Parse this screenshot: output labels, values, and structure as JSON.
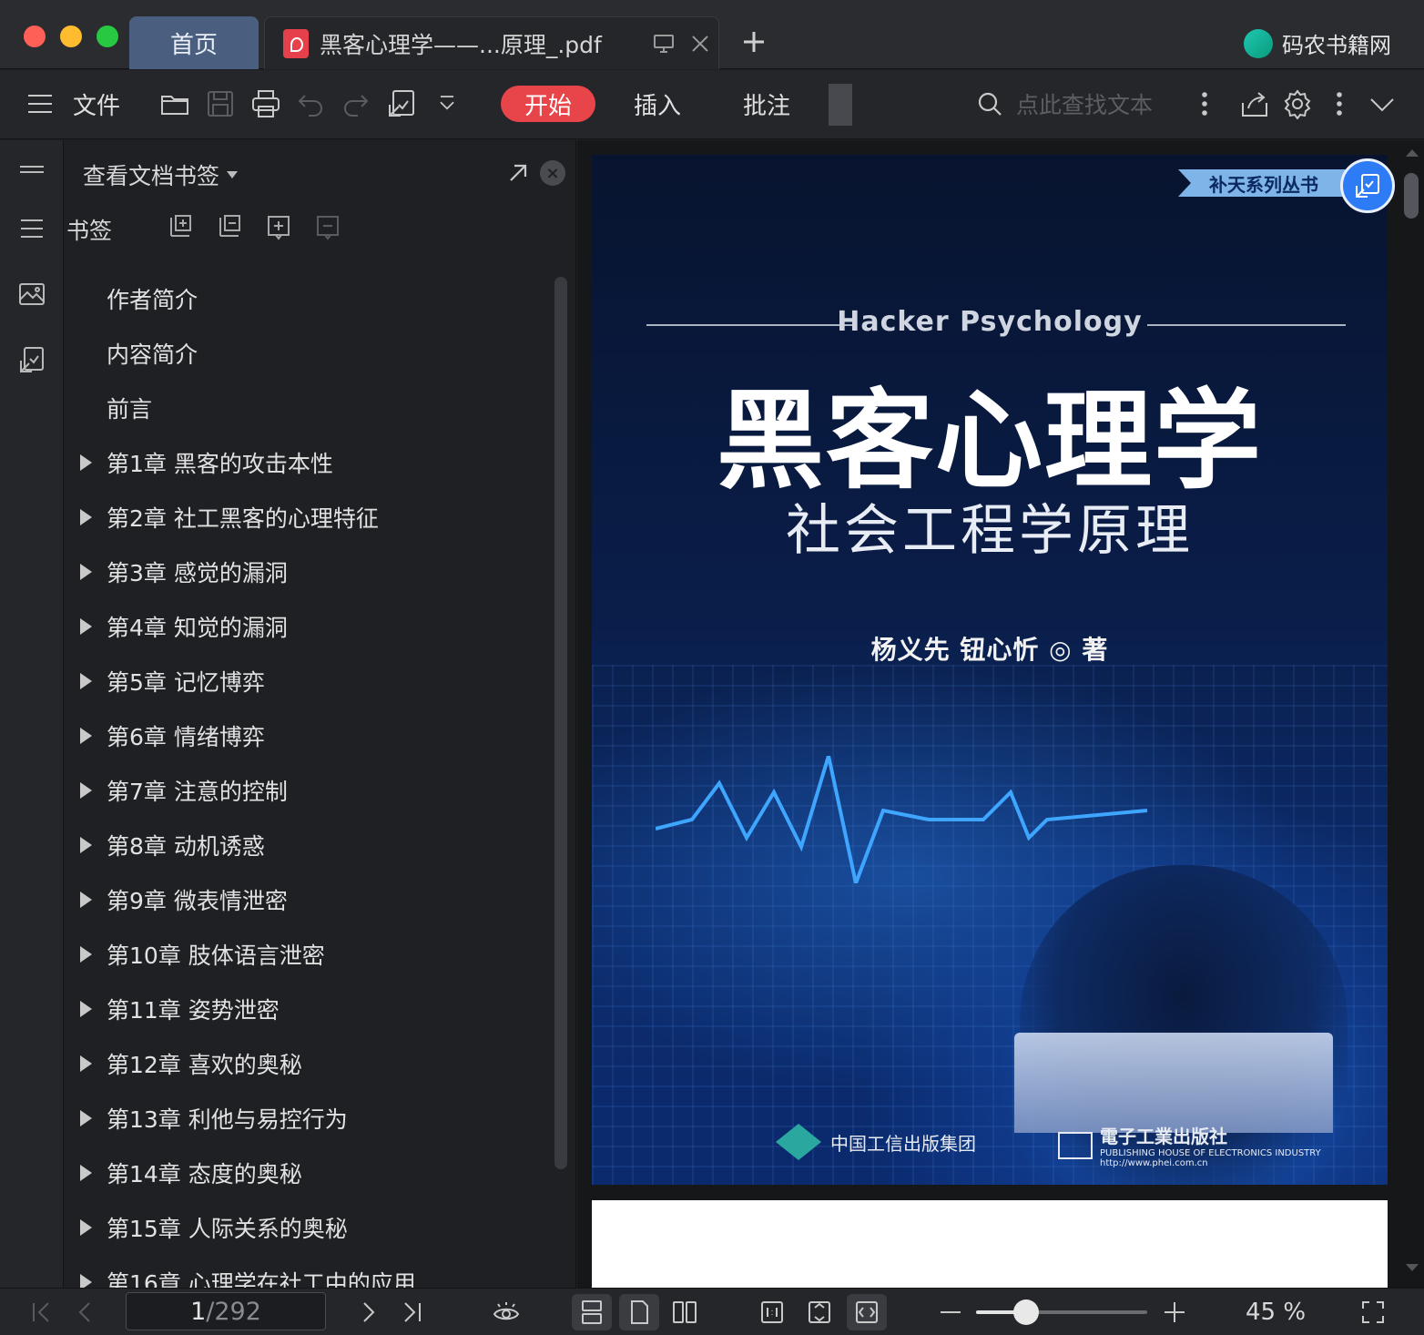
{
  "window": {
    "home_tab": "首页",
    "doc_tab": "黑客心理学——...原理_.pdf",
    "brand": "码农书籍网"
  },
  "toolbar": {
    "file_label": "文件",
    "tabs": [
      "开始",
      "插入",
      "批注"
    ],
    "active_tab": "开始",
    "search_placeholder": "点此查找文本"
  },
  "bookmark_panel": {
    "header": "查看文档书签",
    "section_label": "书签",
    "items": [
      {
        "label": "作者简介",
        "expandable": false
      },
      {
        "label": "内容简介",
        "expandable": false
      },
      {
        "label": "前言",
        "expandable": false
      },
      {
        "label": "第1章 黑客的攻击本性",
        "expandable": true
      },
      {
        "label": "第2章 社工黑客的心理特征",
        "expandable": true
      },
      {
        "label": "第3章 感觉的漏洞",
        "expandable": true
      },
      {
        "label": "第4章 知觉的漏洞",
        "expandable": true
      },
      {
        "label": "第5章 记忆博弈",
        "expandable": true
      },
      {
        "label": "第6章 情绪博弈",
        "expandable": true
      },
      {
        "label": "第7章 注意的控制",
        "expandable": true
      },
      {
        "label": "第8章 动机诱惑",
        "expandable": true
      },
      {
        "label": "第9章 微表情泄密",
        "expandable": true
      },
      {
        "label": "第10章 肢体语言泄密",
        "expandable": true
      },
      {
        "label": "第11章 姿势泄密",
        "expandable": true
      },
      {
        "label": "第12章 喜欢的奥秘",
        "expandable": true
      },
      {
        "label": "第13章 利他与易控行为",
        "expandable": true
      },
      {
        "label": "第14章 态度的奥秘",
        "expandable": true
      },
      {
        "label": "第15章 人际关系的奥秘",
        "expandable": true
      },
      {
        "label": "第16章 心理学在社工中的应用",
        "expandable": true
      }
    ]
  },
  "cover": {
    "series": "补天系列丛书",
    "english_title": "Hacker Psychology",
    "title": "黑客心理学",
    "subtitle": "社会工程学原理",
    "authors": "杨义先   钮心忻  ◎  著",
    "publisher1": "中国工信出版集团",
    "publisher2": "電子工業出版社",
    "publisher2_sub": "PUBLISHING HOUSE OF ELECTRONICS INDUSTRY",
    "publisher2_url": "http://www.phei.com.cn"
  },
  "status": {
    "current_page": "1",
    "total_pages": "/292",
    "zoom_label": "45 %",
    "zoom_level": 0.29
  },
  "colors": {
    "accent": "#e7454a",
    "home_tab": "#4a5f80"
  }
}
